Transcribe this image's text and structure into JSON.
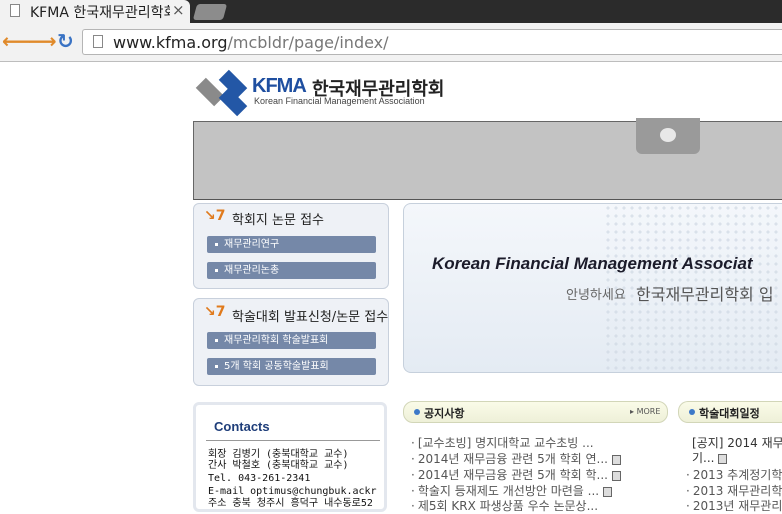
{
  "browser": {
    "tab_title": "KFMA 한국재무관리학회",
    "tab_close": "×",
    "url_domain": "www.kfma.org",
    "url_path": "/mcbldr/page/index/"
  },
  "logo": {
    "abbr": "KFMA",
    "name_ko": "한국재무관리학회",
    "name_en": "Korean Financial Management Association"
  },
  "sidebar": {
    "journal": {
      "title": "학회지 논문 접수",
      "items": [
        "재무관리연구",
        "재무관리논총"
      ]
    },
    "conference": {
      "title": "학술대회 발표신청/논문 접수",
      "items": [
        "재무관리학회 학술발표회",
        "5개 학회 공동학술발표회"
      ]
    }
  },
  "main_visual": {
    "title_en": "Korean Financial Management Associat",
    "greeting": "안녕하세요",
    "greeting_name": "한국재무관리학회 입"
  },
  "contacts": {
    "title": "Contacts",
    "lines": [
      "회장 김병기 (충북대학교 교수)",
      "간사 박철호 (충북대학교 교수)",
      "Tel. 043-261-2341",
      "E-mail optimus@chungbuk.ackr",
      "주소 충북 청주시 흥덕구 내수동로52"
    ]
  },
  "notices": {
    "title": "공지사항",
    "more": "MORE",
    "items": [
      "[교수초빙] 명지대학교 교수초빙 ...",
      "2014년 재무금융 관련 5개 학회 연...",
      "2014년 재무금융 관련 5개 학회 학...",
      "학술지 등재제도 개선방안 마련을 ...",
      "제5회 KRX 파생상품 우수 논문상..."
    ]
  },
  "schedule": {
    "title": "학술대회일정",
    "items": [
      "[공지] 2014 재무",
      "기...",
      "2013 추계정기학",
      "2013 재무관리학",
      "2013년 재무관리"
    ]
  },
  "icons": {
    "back": "arrow-left-icon",
    "forward": "arrow-right-icon",
    "reload": "reload-icon"
  },
  "colors": {
    "accent_blue": "#1f4fa0",
    "pill": "#7588a8",
    "icon_orange": "#e07a1c"
  }
}
